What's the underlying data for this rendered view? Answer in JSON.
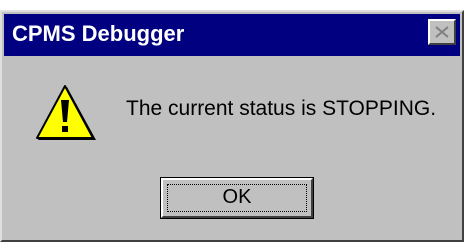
{
  "window": {
    "title": "CPMS Debugger",
    "close_icon": "close-icon"
  },
  "dialog": {
    "icon": "warning-icon",
    "message": "The current status is STOPPING.",
    "ok_label": "OK"
  },
  "colors": {
    "titlebar": "#000080",
    "face": "#c0c0c0",
    "warning_fill": "#ffff00"
  }
}
